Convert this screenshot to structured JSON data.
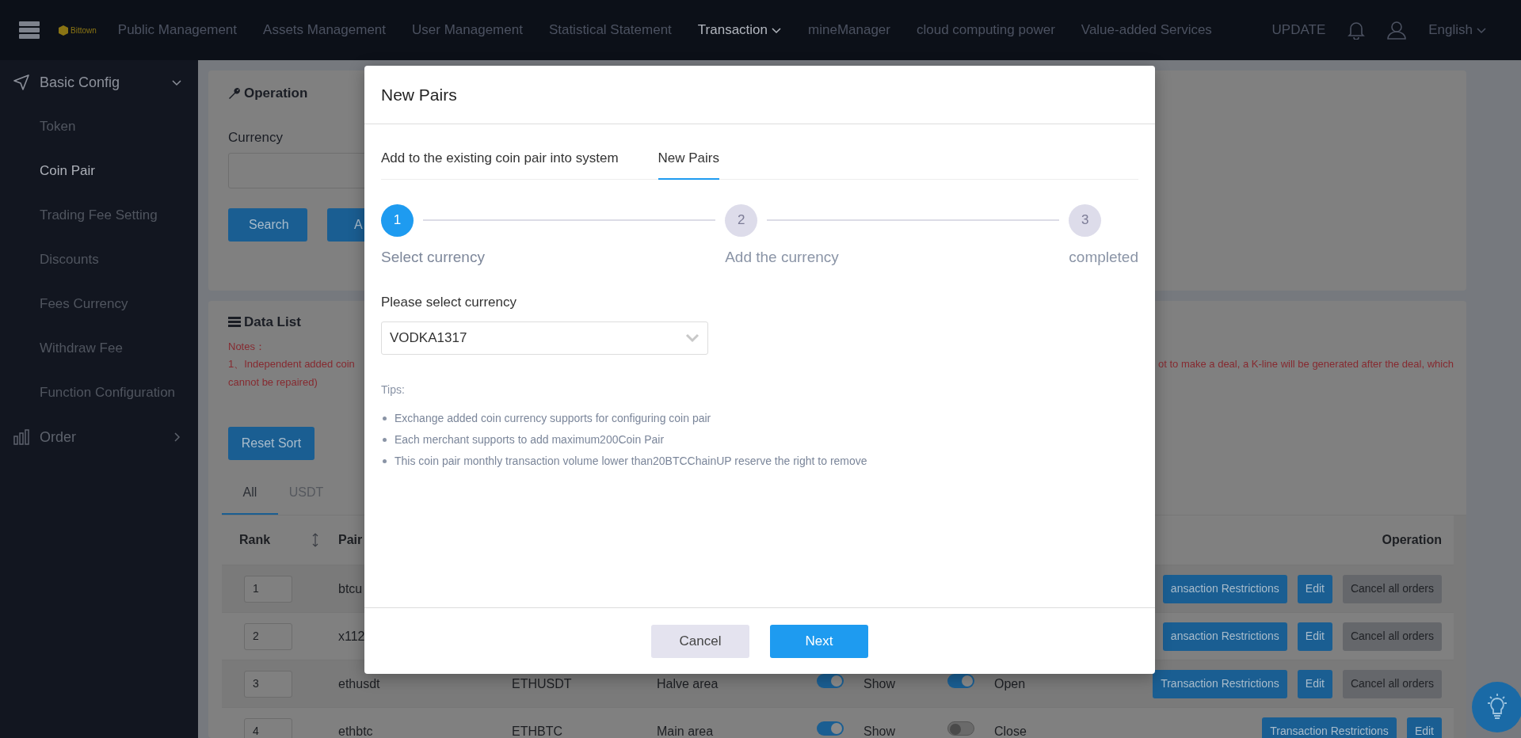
{
  "logo": {
    "text": "Bittown"
  },
  "nav": {
    "items": [
      {
        "label": "Public Management",
        "selected": false,
        "dropdown": false
      },
      {
        "label": "Assets Management",
        "selected": false,
        "dropdown": false
      },
      {
        "label": "User Management",
        "selected": false,
        "dropdown": false
      },
      {
        "label": "Statistical Statement",
        "selected": false,
        "dropdown": false
      },
      {
        "label": "Transaction",
        "selected": true,
        "dropdown": true
      },
      {
        "label": "mineManager",
        "selected": false,
        "dropdown": false
      },
      {
        "label": "cloud computing power",
        "selected": false,
        "dropdown": false
      },
      {
        "label": "Value-added Services",
        "selected": false,
        "dropdown": false
      }
    ],
    "update": "UPDATE",
    "language": "English"
  },
  "sidebar": {
    "groups": [
      {
        "label": "Basic Config",
        "expanded": true,
        "children": [
          {
            "label": "Token",
            "selected": false
          },
          {
            "label": "Coin Pair",
            "selected": true
          },
          {
            "label": "Trading Fee Setting",
            "selected": false
          },
          {
            "label": "Discounts",
            "selected": false
          },
          {
            "label": "Fees Currency",
            "selected": false
          },
          {
            "label": "Withdraw Fee",
            "selected": false
          },
          {
            "label": "Function Configuration",
            "selected": false
          }
        ]
      },
      {
        "label": "Order",
        "expanded": false
      }
    ]
  },
  "operation_panel": {
    "title": "Operation",
    "currency_label": "Currency",
    "buttons": [
      "Search",
      "A"
    ]
  },
  "data_list": {
    "title": "Data List",
    "notes_label": "Notes：",
    "note_start": "1、Independent added coin",
    "note_end": "ot to make a deal, a K-line will be generated after the deal, which",
    "note_line_2": "cannot be repaired)",
    "reset_button": "Reset Sort",
    "tabs": [
      {
        "label": "All",
        "selected": true
      },
      {
        "label": "USDT",
        "selected": false
      }
    ],
    "table": {
      "columns": [
        {
          "label": "Rank"
        },
        {
          "label": "Pair"
        },
        {
          "label": "Operation"
        }
      ],
      "rows": [
        {
          "rank": "1",
          "pair": "btcu",
          "actions": [
            {
              "label": "ansaction Restrictions",
              "kind": "primary"
            },
            {
              "label": "Edit",
              "kind": "primary"
            },
            {
              "label": "Cancel all orders",
              "kind": "secondary"
            }
          ]
        },
        {
          "rank": "2",
          "pair": "x112",
          "actions": [
            {
              "label": "ansaction Restrictions",
              "kind": "primary"
            },
            {
              "label": "Edit",
              "kind": "primary"
            },
            {
              "label": "Cancel all orders",
              "kind": "secondary"
            }
          ]
        },
        {
          "rank": "3",
          "pair": "ethusdt",
          "code": "ETHUSDT",
          "area": "Halve area",
          "show_on": true,
          "show_label": "Show",
          "open_on": true,
          "open_label": "Open",
          "actions": [
            {
              "label": "Transaction Restrictions",
              "kind": "primary"
            },
            {
              "label": "Edit",
              "kind": "primary"
            },
            {
              "label": "Cancel all orders",
              "kind": "secondary"
            }
          ]
        },
        {
          "rank": "4",
          "pair": "ethbtc",
          "code": "ETHBTC",
          "area": "Main area",
          "show_on": true,
          "show_label": "Show",
          "open_on": false,
          "open_label": "Close",
          "actions": [
            {
              "label": "Transaction Restrictions",
              "kind": "primary"
            },
            {
              "label": "Edit",
              "kind": "primary"
            }
          ]
        }
      ]
    }
  },
  "modal": {
    "title": "New Pairs",
    "tabs": [
      {
        "label": "Add to the existing coin pair into system",
        "selected": false
      },
      {
        "label": "New Pairs",
        "selected": true
      }
    ],
    "steps": [
      {
        "number": "1",
        "label": "Select currency",
        "active": true
      },
      {
        "number": "2",
        "label": "Add the currency",
        "active": false
      },
      {
        "number": "3",
        "label": "completed",
        "active": false
      }
    ],
    "field": {
      "label": "Please select currency",
      "value": "VODKA1317"
    },
    "tips": {
      "title": "Tips:",
      "items": [
        "Exchange added coin currency supports for configuring coin pair",
        "Each merchant supports to add maximum200Coin Pair",
        "This coin pair monthly transaction volume lower than20BTCChainUP reserve the right to remove"
      ]
    },
    "buttons": [
      {
        "label": "Cancel",
        "kind": "secondary"
      },
      {
        "label": "Next",
        "kind": "primary"
      }
    ]
  }
}
